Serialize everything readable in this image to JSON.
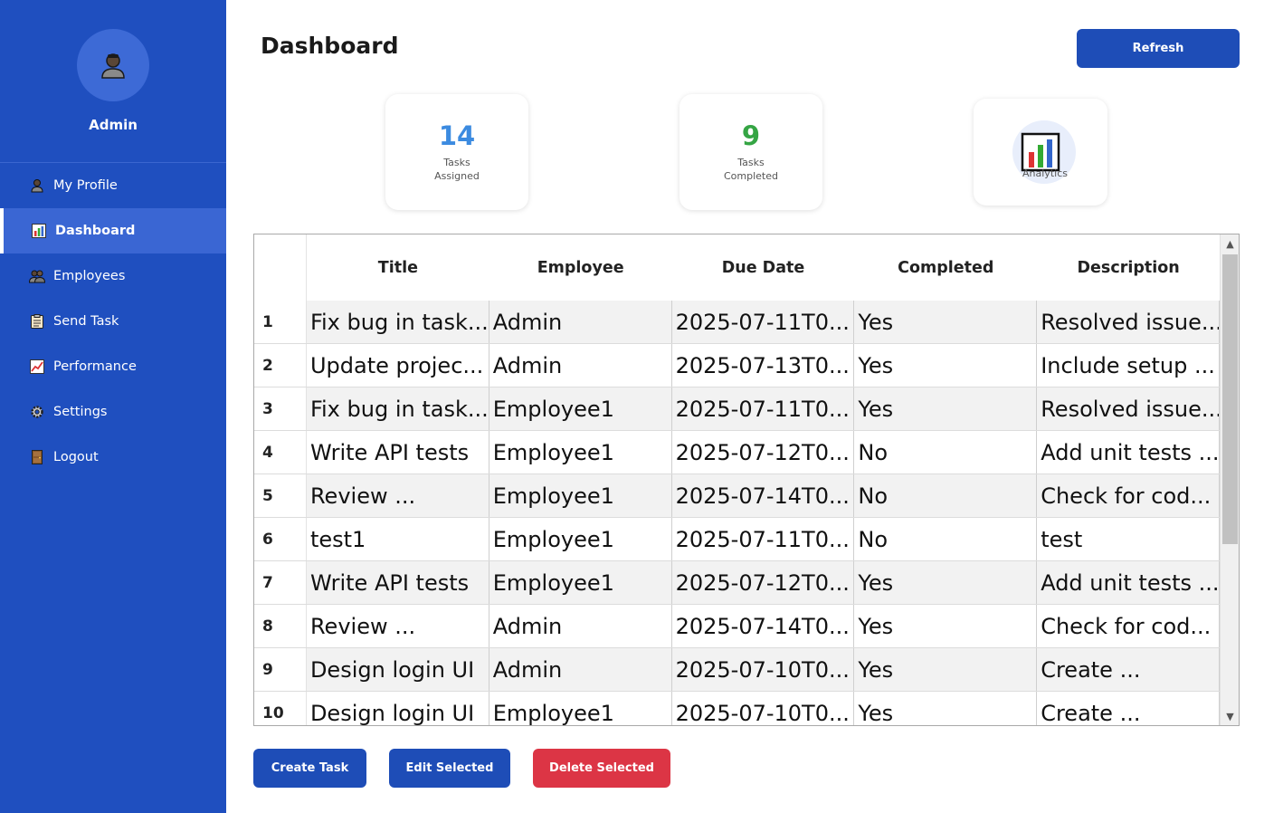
{
  "sidebar": {
    "user_name": "Admin",
    "items": [
      {
        "label": "My Profile",
        "icon": "person-icon"
      },
      {
        "label": "Dashboard",
        "icon": "bar-chart-icon",
        "active": true
      },
      {
        "label": "Employees",
        "icon": "people-icon"
      },
      {
        "label": "Send Task",
        "icon": "clipboard-icon"
      },
      {
        "label": "Performance",
        "icon": "line-chart-icon"
      },
      {
        "label": "Settings",
        "icon": "gear-icon"
      },
      {
        "label": "Logout",
        "icon": "door-icon"
      }
    ]
  },
  "header": {
    "title": "Dashboard",
    "refresh_label": "Refresh"
  },
  "stats": {
    "assigned": {
      "value": "14",
      "label_line1": "Tasks",
      "label_line2": "Assigned"
    },
    "completed": {
      "value": "9",
      "label_line1": "Tasks",
      "label_line2": "Completed"
    },
    "analytics": {
      "label": "Analytics"
    }
  },
  "table": {
    "columns": [
      "Title",
      "Employee",
      "Due Date",
      "Completed",
      "Description"
    ],
    "rows": [
      {
        "index": "1",
        "cells": [
          "Fix bug in task...",
          "Admin",
          "2025-07-11T0...",
          "Yes",
          "Resolved issue..."
        ]
      },
      {
        "index": "2",
        "cells": [
          "Update projec...",
          "Admin",
          "2025-07-13T0...",
          "Yes",
          "Include setup ..."
        ]
      },
      {
        "index": "3",
        "cells": [
          "Fix bug in task...",
          "Employee1",
          "2025-07-11T0...",
          "Yes",
          "Resolved issue..."
        ]
      },
      {
        "index": "4",
        "cells": [
          "Write API tests",
          "Employee1",
          "2025-07-12T0...",
          "No",
          "Add unit tests ..."
        ]
      },
      {
        "index": "5",
        "cells": [
          "Review ...",
          "Employee1",
          "2025-07-14T0...",
          "No",
          "Check for cod..."
        ]
      },
      {
        "index": "6",
        "cells": [
          "test1",
          "Employee1",
          "2025-07-11T0...",
          "No",
          "test"
        ]
      },
      {
        "index": "7",
        "cells": [
          "Write API tests",
          "Employee1",
          "2025-07-12T0...",
          "Yes",
          "Add unit tests ..."
        ]
      },
      {
        "index": "8",
        "cells": [
          "Review ...",
          "Admin",
          "2025-07-14T0...",
          "Yes",
          "Check for cod..."
        ]
      },
      {
        "index": "9",
        "cells": [
          "Design login UI",
          "Admin",
          "2025-07-10T0...",
          "Yes",
          "Create ..."
        ]
      },
      {
        "index": "10",
        "cells": [
          "Design login UI",
          "Employee1",
          "2025-07-10T0...",
          "Yes",
          "Create ..."
        ]
      }
    ]
  },
  "actions": {
    "create_label": "Create Task",
    "edit_label": "Edit Selected",
    "delete_label": "Delete Selected"
  },
  "colors": {
    "sidebar_bg": "#1f4fbf",
    "primary_button": "#1e4db7",
    "danger_button": "#dc3545",
    "assigned_number": "#3c8be0",
    "completed_number": "#35a544"
  }
}
